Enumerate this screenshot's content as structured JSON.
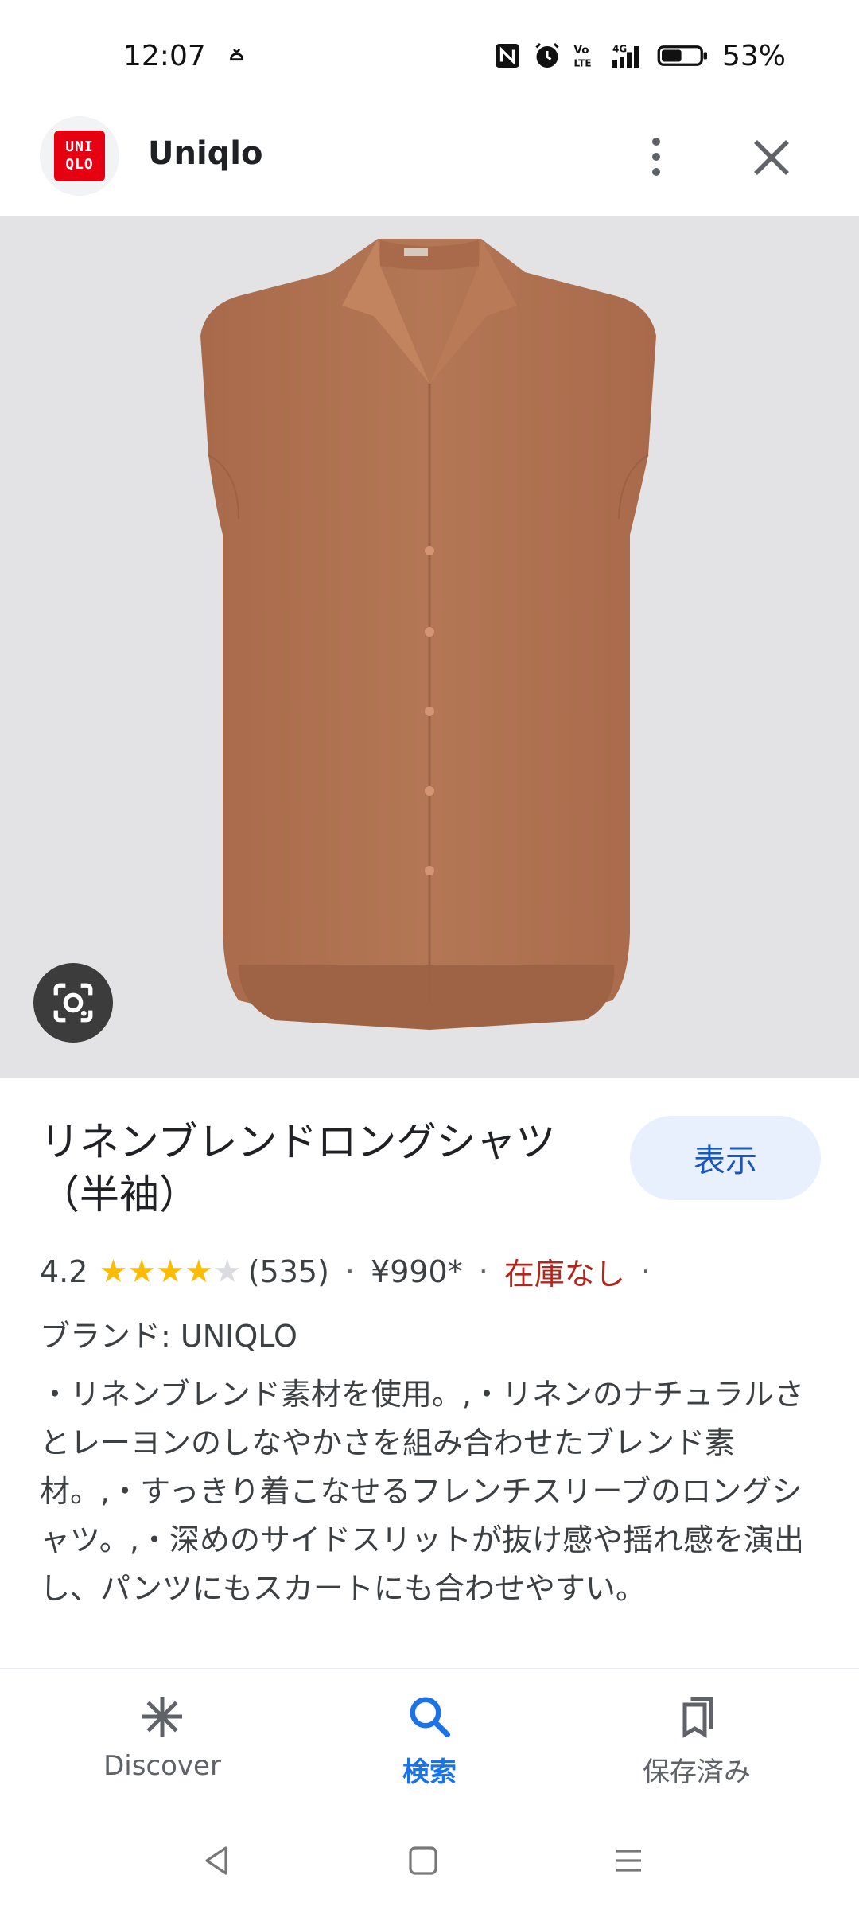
{
  "status_bar": {
    "time": "12:07",
    "battery_percent": "53%",
    "battery_level": 0.53,
    "icons": [
      "nfc-icon",
      "alarm-icon",
      "volte-icon",
      "4g-signal-icon",
      "battery-icon"
    ]
  },
  "header": {
    "logo_top": "UNI",
    "logo_bottom": "QLO",
    "site_name": "Uniqlo"
  },
  "product": {
    "title": "リネンブレンドロングシャツ（半袖）",
    "view_button": "表示",
    "rating": "4.2",
    "rating_value": 4.2,
    "rating_max": 5,
    "review_count": "(535)",
    "price": "¥990*",
    "stock": "在庫なし",
    "separator": "·",
    "brand_line": "ブランド: UNIQLO",
    "description": "・リネンブレンド素材を使用。,・リネンのナチュラルさとレーヨンのしなやかさを組み合わせたブレンド素材。,・すっきり着こなせるフレンチスリーブのロングシャツ。,・深めのサイドスリットが抜け感や揺れ感を演出し、パンツにもスカートにも合わせやすい。"
  },
  "bottom_nav": {
    "items": [
      {
        "label": "Discover",
        "icon": "asterisk-icon",
        "active": false
      },
      {
        "label": "検索",
        "icon": "search-icon",
        "active": true
      },
      {
        "label": "保存済み",
        "icon": "bookmarks-icon",
        "active": false
      }
    ]
  },
  "colors": {
    "accent": "#1a73e8",
    "stock_red": "#b3261e",
    "star": "#fbbc04",
    "shirt": "#b07453",
    "image_bg": "#e3e3e6"
  }
}
